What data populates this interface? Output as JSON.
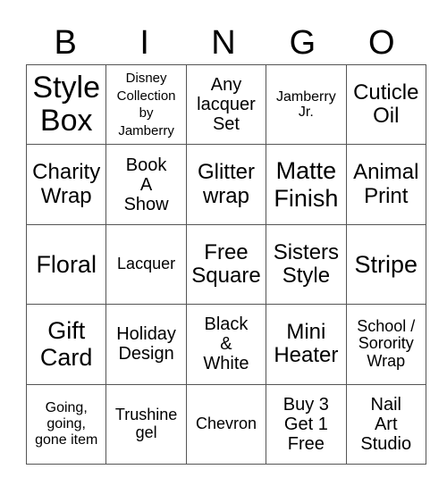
{
  "title": "BINGO",
  "header_letters": [
    "B",
    "I",
    "N",
    "G",
    "O"
  ],
  "cells": [
    [
      "Style\nBox",
      "Disney\nCollection\nby\nJamberry",
      "Any\nlacquer\nSet",
      "Jamberry\nJr.",
      "Cuticle\nOil"
    ],
    [
      "Charity\nWrap",
      "Book\nA\nShow",
      "Glitter\nwrap",
      "Matte\nFinish",
      "Animal\nPrint"
    ],
    [
      "Floral",
      "Lacquer",
      "Free\nSquare",
      "Sisters\nStyle",
      "Stripe"
    ],
    [
      "Gift\nCard",
      "Holiday\nDesign",
      "Black\n&\nWhite",
      "Mini\nHeater",
      "School /\nSorority\nWrap"
    ],
    [
      "Going,\ngoing,\ngone item",
      "Trushine\ngel",
      "Chevron",
      "Buy 3\nGet 1\nFree",
      "Nail\nArt\nStudio"
    ]
  ]
}
